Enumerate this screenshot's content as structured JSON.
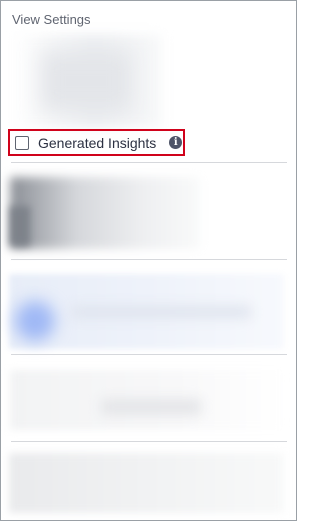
{
  "panel": {
    "title": "View Settings"
  },
  "options": [
    {
      "label": "Generated Insights",
      "checked": false,
      "info_icon": "info-icon",
      "highlight_color": "#d0021b"
    }
  ]
}
